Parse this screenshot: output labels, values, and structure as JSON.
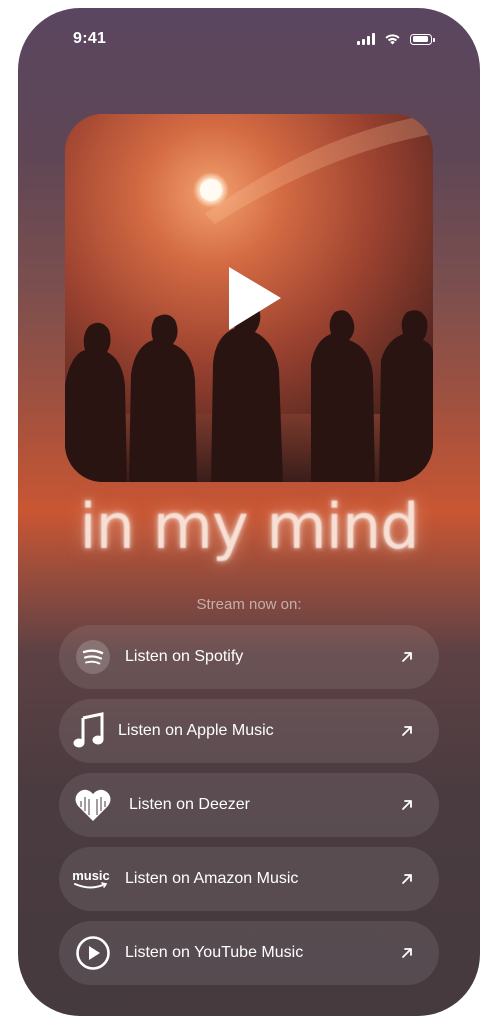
{
  "status_bar": {
    "time": "9:41"
  },
  "cover": {
    "play_icon": "play-icon"
  },
  "track": {
    "title": "in my mind"
  },
  "stream": {
    "label": "Stream now on:"
  },
  "links": [
    {
      "label": "Listen on Spotify",
      "icon": "spotify-icon"
    },
    {
      "label": "Listen on Apple Music",
      "icon": "music-note-icon"
    },
    {
      "label": "Listen on Deezer",
      "icon": "deezer-heart-icon"
    },
    {
      "label": "Listen on Amazon Music",
      "icon": "amazon-music-icon",
      "icon_text": "music"
    },
    {
      "label": "Listen on YouTube Music",
      "icon": "youtube-music-icon"
    }
  ],
  "colors": {
    "accent": "#c95633",
    "background_top": "#5a4660",
    "background_bottom": "#453a3e",
    "title_glow": "#f7dfd4"
  }
}
